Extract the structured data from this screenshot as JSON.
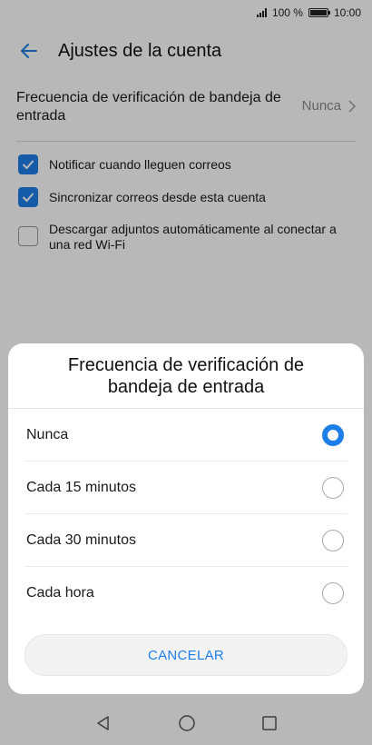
{
  "status_bar": {
    "battery": "100 %",
    "time": "10:00"
  },
  "app_bar": {
    "title": "Ajustes de la cuenta"
  },
  "settings": {
    "frequency_label": "Frecuencia de verificación de bandeja de entrada",
    "frequency_value": "Nunca",
    "checkboxes": [
      {
        "label": "Notificar cuando lleguen correos",
        "checked": true
      },
      {
        "label": "Sincronizar correos desde esta cuenta",
        "checked": true
      },
      {
        "label": "Descargar adjuntos automáticamente al conectar a una red Wi-Fi",
        "checked": false
      }
    ]
  },
  "dialog": {
    "title": "Frecuencia de verificación de bandeja de entrada",
    "options": [
      {
        "label": "Nunca",
        "selected": true
      },
      {
        "label": "Cada 15 minutos",
        "selected": false
      },
      {
        "label": "Cada 30 minutos",
        "selected": false
      },
      {
        "label": "Cada hora",
        "selected": false
      }
    ],
    "cancel_label": "CANCELAR"
  },
  "colors": {
    "accent": "#1e7ee8",
    "scrim": "rgba(0,0,0,0.28)"
  },
  "icons": [
    "signal-icon",
    "battery-icon",
    "back-arrow-icon",
    "chevron-right-icon",
    "checkmark-icon",
    "nav-back-icon",
    "nav-home-icon",
    "nav-recents-icon"
  ]
}
